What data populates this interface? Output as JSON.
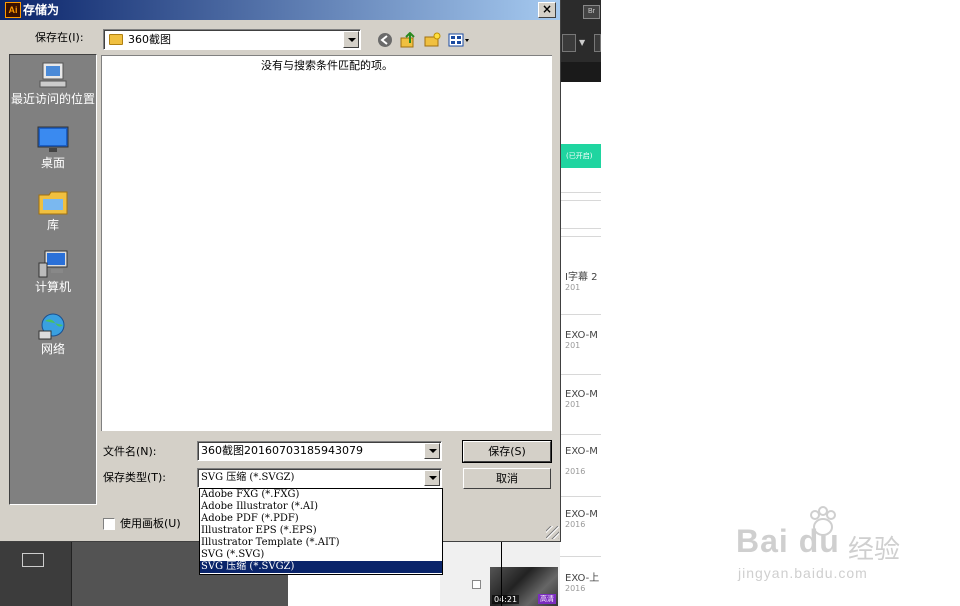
{
  "dialog": {
    "title": "存储为",
    "app_logo": "Ai",
    "close_glyph": "×",
    "save_in_label": "保存在(I):",
    "current_folder": "360截图",
    "empty_message": "没有与搜索条件匹配的项。",
    "places": [
      {
        "label": "最近访问的位置",
        "icon": "recent-places-icon"
      },
      {
        "label": "桌面",
        "icon": "desktop-icon"
      },
      {
        "label": "库",
        "icon": "library-icon"
      },
      {
        "label": "计算机",
        "icon": "computer-icon"
      },
      {
        "label": "网络",
        "icon": "network-icon"
      }
    ],
    "file_name_label": "文件名(N):",
    "file_name_value": "360截图20160703185943079",
    "file_type_label": "保存类型(T):",
    "file_type_value": "SVG 压缩 (*.SVGZ)",
    "use_artboards_label": "使用画板(U)",
    "save_button": "保存(S)",
    "cancel_button": "取消",
    "file_type_options": [
      "Adobe FXG (*.FXG)",
      "Adobe Illustrator (*.AI)",
      "Adobe PDF (*.PDF)",
      "Illustrator EPS (*.EPS)",
      "Illustrator Template (*.AIT)",
      "SVG (*.SVG)",
      "SVG 压缩 (*.SVGZ)"
    ],
    "selected_option_index": 6
  },
  "background": {
    "br_badge": "Br",
    "green_banner": "(已开启)",
    "list_items": [
      {
        "title": "I字幕 2",
        "date": "201"
      },
      {
        "title": "EXO-M",
        "date": "201"
      },
      {
        "title": "EXO-M",
        "date": "201"
      },
      {
        "title": "EXO-M",
        "date": "2016"
      },
      {
        "title": "EXO-M",
        "date": "2016"
      },
      {
        "title": "EXO-上",
        "date": "2016"
      }
    ],
    "thumb_time": "04:21",
    "thumb_tag": "高清"
  },
  "watermark": {
    "brand": "Bai  du",
    "cn": "经验",
    "url": "jingyan.baidu.com"
  },
  "colors": {
    "dialog_face": "#d4d0c8",
    "title_start": "#0a246a",
    "title_end": "#a6caf0",
    "selection": "#0a246a",
    "places_bg": "#808080",
    "green_banner": "#1fd5a0"
  }
}
